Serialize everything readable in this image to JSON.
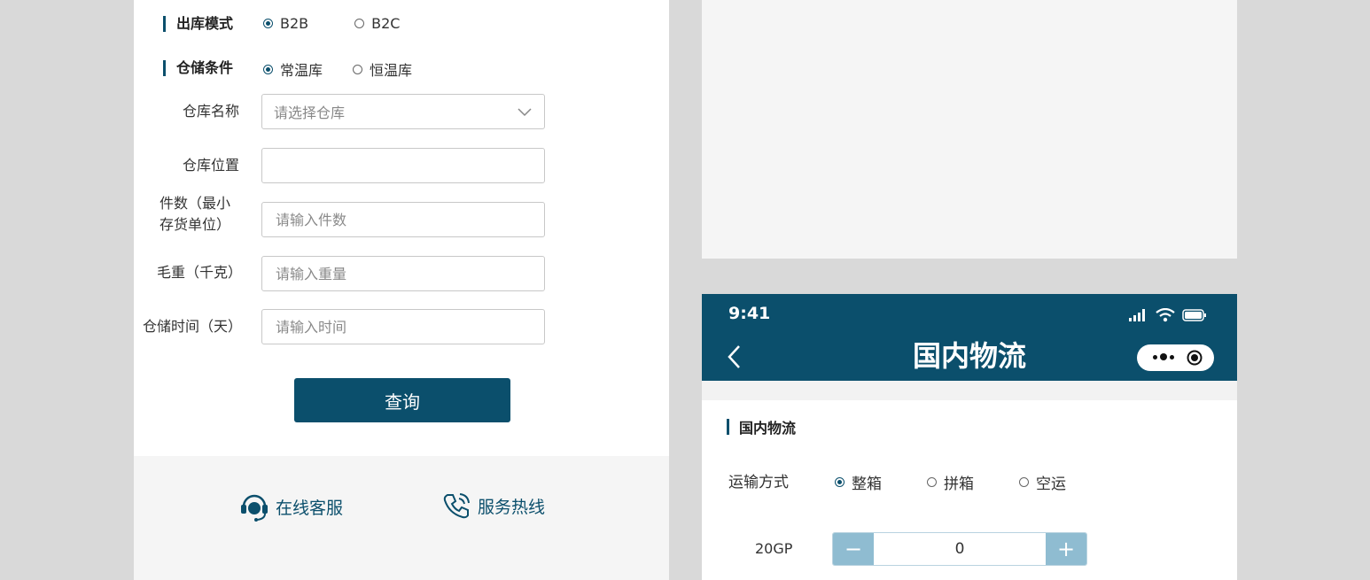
{
  "left_form": {
    "outbound_mode": {
      "label": "出库模式",
      "options": [
        {
          "label": "B2B",
          "checked": true
        },
        {
          "label": "B2C",
          "checked": false
        }
      ]
    },
    "storage_condition": {
      "label": "仓储条件",
      "options": [
        {
          "label": "常温库",
          "checked": true
        },
        {
          "label": "恒温库",
          "checked": false
        }
      ]
    },
    "warehouse_name": {
      "label": "仓库名称",
      "placeholder": "请选择仓库"
    },
    "warehouse_location": {
      "label": "仓库位置",
      "value": ""
    },
    "quantity": {
      "label_line1": "件数（最小",
      "label_line2": "存货单位）",
      "placeholder": "请输入件数"
    },
    "gross_weight": {
      "label": "毛重（千克）",
      "placeholder": "请输入重量"
    },
    "storage_time": {
      "label": "仓储时间（天）",
      "placeholder": "请输入时间"
    },
    "query_label": "查询"
  },
  "footer": {
    "online_service": "在线客服",
    "service_hotline": "服务热线"
  },
  "phone": {
    "status_time": "9:41",
    "nav_title": "国内物流",
    "section_title": "国内物流",
    "transport": {
      "label": "运输方式",
      "options": [
        {
          "label": "整箱",
          "checked": true
        },
        {
          "label": "拼箱",
          "checked": false
        },
        {
          "label": "空运",
          "checked": false
        }
      ]
    },
    "container": {
      "label": "20GP",
      "value": "0",
      "minus": "−",
      "plus": "+"
    }
  },
  "colors": {
    "primary": "#0b4f6c",
    "stepper_button": "#8fbcd1",
    "panel_gray": "#f5f5f5",
    "background": "#d9d9d9"
  },
  "icons": [
    "chevron-down-icon",
    "headset-icon",
    "phone-icon",
    "signal-icon",
    "wifi-icon",
    "battery-icon",
    "back-arrow-icon",
    "more-dots-icon",
    "target-icon"
  ]
}
